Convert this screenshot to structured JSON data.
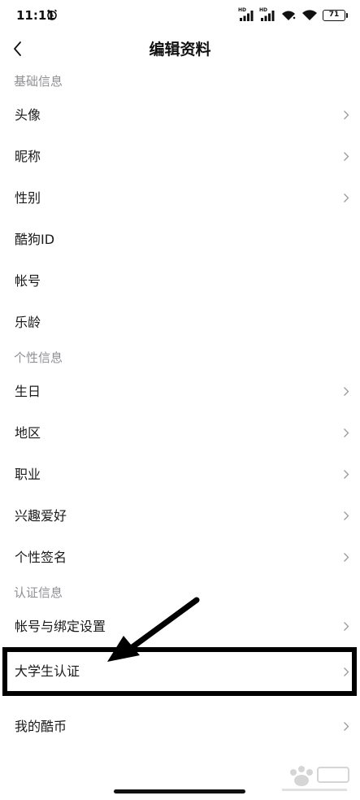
{
  "status_bar": {
    "time": "11:11",
    "battery": "71",
    "hd_label": "HD",
    "icons": [
      "alarm-icon",
      "signal-icon",
      "signal-icon",
      "wifi-icon",
      "wifi-icon",
      "battery-icon"
    ]
  },
  "header": {
    "title": "编辑资料",
    "back_icon": "chevron-left-icon"
  },
  "sections": [
    {
      "title": "基础信息",
      "items": [
        {
          "label": "头像",
          "chevron": true
        },
        {
          "label": "昵称",
          "chevron": true
        },
        {
          "label": "性别",
          "chevron": true
        },
        {
          "label": "酷狗ID",
          "chevron": false
        },
        {
          "label": "帐号",
          "chevron": false
        },
        {
          "label": "乐龄",
          "chevron": false
        }
      ]
    },
    {
      "title": "个性信息",
      "items": [
        {
          "label": "生日",
          "chevron": true
        },
        {
          "label": "地区",
          "chevron": true
        },
        {
          "label": "职业",
          "chevron": true
        },
        {
          "label": "兴趣爱好",
          "chevron": true
        },
        {
          "label": "个性签名",
          "chevron": true
        }
      ]
    },
    {
      "title": "认证信息",
      "items": [
        {
          "label": "帐号与绑定设置",
          "chevron": true
        },
        {
          "label": "大学生认证",
          "chevron": true
        }
      ]
    },
    {
      "title": "",
      "items": [
        {
          "label": "我的酷币",
          "chevron": true
        }
      ]
    }
  ],
  "annotation": {
    "highlighted_item": "大学生认证",
    "color": "#000000"
  },
  "watermark": {
    "logo": "baidu-jingyan-logo"
  },
  "colors": {
    "text": "#1a1a1a",
    "section_header": "#8f8f94",
    "chevron": "#9a9a9a",
    "background": "#ffffff"
  }
}
